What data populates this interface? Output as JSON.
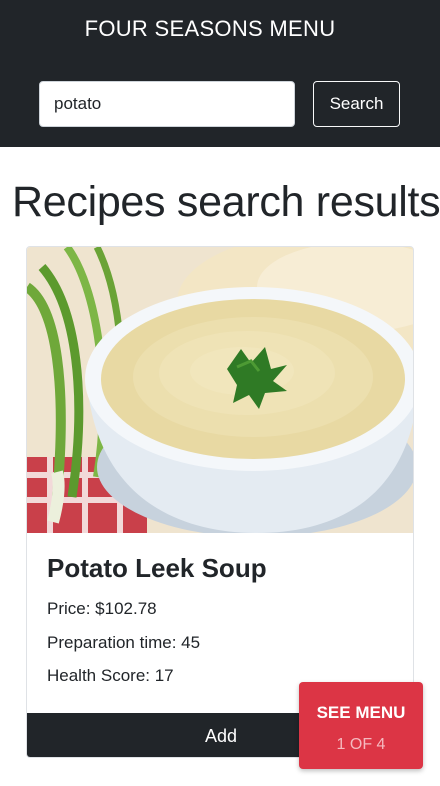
{
  "header": {
    "brand": "FOUR SEASONS MENU",
    "search": {
      "value": "potato",
      "placeholder": "",
      "button_label": "Search"
    }
  },
  "main": {
    "title": "Recipes search results",
    "cards": [
      {
        "title": "Potato Leek Soup",
        "price_text": "Price: $102.78",
        "prep_text": "Preparation time: 45",
        "health_text": "Health Score: 17",
        "add_label": "Add"
      }
    ]
  },
  "floating": {
    "see_menu_label": "SEE MENU",
    "count_text": "1 OF 4"
  },
  "colors": {
    "navbar": "#212529",
    "accent": "#dc3545",
    "button_dark": "#212529"
  }
}
